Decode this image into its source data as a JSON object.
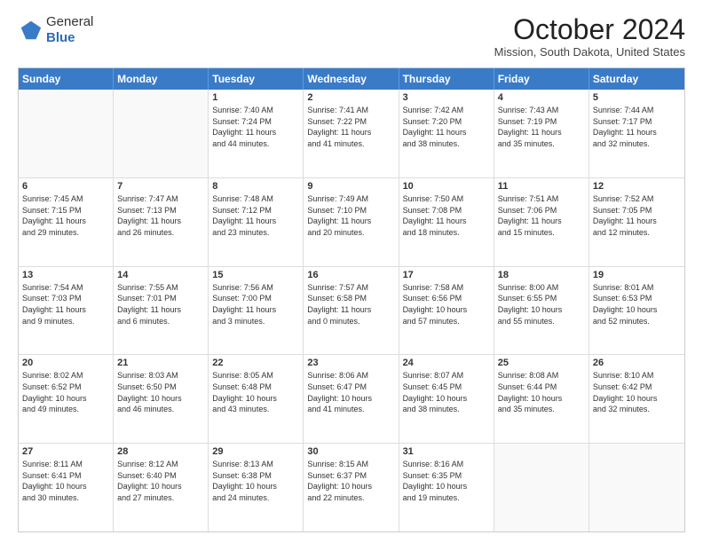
{
  "header": {
    "logo": {
      "line1": "General",
      "line2": "Blue"
    },
    "title": "October 2024",
    "location": "Mission, South Dakota, United States"
  },
  "calendar": {
    "days_of_week": [
      "Sunday",
      "Monday",
      "Tuesday",
      "Wednesday",
      "Thursday",
      "Friday",
      "Saturday"
    ],
    "weeks": [
      [
        {
          "day": "",
          "info": "",
          "empty": true
        },
        {
          "day": "",
          "info": "",
          "empty": true
        },
        {
          "day": "1",
          "info": "Sunrise: 7:40 AM\nSunset: 7:24 PM\nDaylight: 11 hours\nand 44 minutes."
        },
        {
          "day": "2",
          "info": "Sunrise: 7:41 AM\nSunset: 7:22 PM\nDaylight: 11 hours\nand 41 minutes."
        },
        {
          "day": "3",
          "info": "Sunrise: 7:42 AM\nSunset: 7:20 PM\nDaylight: 11 hours\nand 38 minutes."
        },
        {
          "day": "4",
          "info": "Sunrise: 7:43 AM\nSunset: 7:19 PM\nDaylight: 11 hours\nand 35 minutes."
        },
        {
          "day": "5",
          "info": "Sunrise: 7:44 AM\nSunset: 7:17 PM\nDaylight: 11 hours\nand 32 minutes."
        }
      ],
      [
        {
          "day": "6",
          "info": "Sunrise: 7:45 AM\nSunset: 7:15 PM\nDaylight: 11 hours\nand 29 minutes."
        },
        {
          "day": "7",
          "info": "Sunrise: 7:47 AM\nSunset: 7:13 PM\nDaylight: 11 hours\nand 26 minutes."
        },
        {
          "day": "8",
          "info": "Sunrise: 7:48 AM\nSunset: 7:12 PM\nDaylight: 11 hours\nand 23 minutes."
        },
        {
          "day": "9",
          "info": "Sunrise: 7:49 AM\nSunset: 7:10 PM\nDaylight: 11 hours\nand 20 minutes."
        },
        {
          "day": "10",
          "info": "Sunrise: 7:50 AM\nSunset: 7:08 PM\nDaylight: 11 hours\nand 18 minutes."
        },
        {
          "day": "11",
          "info": "Sunrise: 7:51 AM\nSunset: 7:06 PM\nDaylight: 11 hours\nand 15 minutes."
        },
        {
          "day": "12",
          "info": "Sunrise: 7:52 AM\nSunset: 7:05 PM\nDaylight: 11 hours\nand 12 minutes."
        }
      ],
      [
        {
          "day": "13",
          "info": "Sunrise: 7:54 AM\nSunset: 7:03 PM\nDaylight: 11 hours\nand 9 minutes."
        },
        {
          "day": "14",
          "info": "Sunrise: 7:55 AM\nSunset: 7:01 PM\nDaylight: 11 hours\nand 6 minutes."
        },
        {
          "day": "15",
          "info": "Sunrise: 7:56 AM\nSunset: 7:00 PM\nDaylight: 11 hours\nand 3 minutes."
        },
        {
          "day": "16",
          "info": "Sunrise: 7:57 AM\nSunset: 6:58 PM\nDaylight: 11 hours\nand 0 minutes."
        },
        {
          "day": "17",
          "info": "Sunrise: 7:58 AM\nSunset: 6:56 PM\nDaylight: 10 hours\nand 57 minutes."
        },
        {
          "day": "18",
          "info": "Sunrise: 8:00 AM\nSunset: 6:55 PM\nDaylight: 10 hours\nand 55 minutes."
        },
        {
          "day": "19",
          "info": "Sunrise: 8:01 AM\nSunset: 6:53 PM\nDaylight: 10 hours\nand 52 minutes."
        }
      ],
      [
        {
          "day": "20",
          "info": "Sunrise: 8:02 AM\nSunset: 6:52 PM\nDaylight: 10 hours\nand 49 minutes."
        },
        {
          "day": "21",
          "info": "Sunrise: 8:03 AM\nSunset: 6:50 PM\nDaylight: 10 hours\nand 46 minutes."
        },
        {
          "day": "22",
          "info": "Sunrise: 8:05 AM\nSunset: 6:48 PM\nDaylight: 10 hours\nand 43 minutes."
        },
        {
          "day": "23",
          "info": "Sunrise: 8:06 AM\nSunset: 6:47 PM\nDaylight: 10 hours\nand 41 minutes."
        },
        {
          "day": "24",
          "info": "Sunrise: 8:07 AM\nSunset: 6:45 PM\nDaylight: 10 hours\nand 38 minutes."
        },
        {
          "day": "25",
          "info": "Sunrise: 8:08 AM\nSunset: 6:44 PM\nDaylight: 10 hours\nand 35 minutes."
        },
        {
          "day": "26",
          "info": "Sunrise: 8:10 AM\nSunset: 6:42 PM\nDaylight: 10 hours\nand 32 minutes."
        }
      ],
      [
        {
          "day": "27",
          "info": "Sunrise: 8:11 AM\nSunset: 6:41 PM\nDaylight: 10 hours\nand 30 minutes."
        },
        {
          "day": "28",
          "info": "Sunrise: 8:12 AM\nSunset: 6:40 PM\nDaylight: 10 hours\nand 27 minutes."
        },
        {
          "day": "29",
          "info": "Sunrise: 8:13 AM\nSunset: 6:38 PM\nDaylight: 10 hours\nand 24 minutes."
        },
        {
          "day": "30",
          "info": "Sunrise: 8:15 AM\nSunset: 6:37 PM\nDaylight: 10 hours\nand 22 minutes."
        },
        {
          "day": "31",
          "info": "Sunrise: 8:16 AM\nSunset: 6:35 PM\nDaylight: 10 hours\nand 19 minutes."
        },
        {
          "day": "",
          "info": "",
          "empty": true
        },
        {
          "day": "",
          "info": "",
          "empty": true
        }
      ]
    ]
  }
}
